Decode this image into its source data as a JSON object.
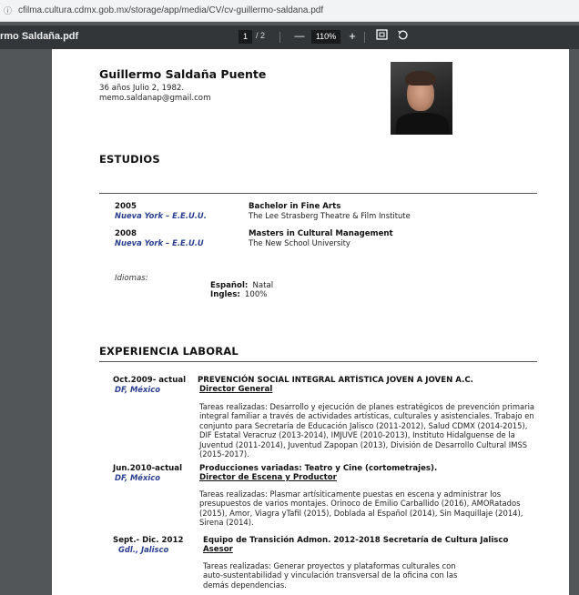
{
  "browser": {
    "url": "cfilma.cultura.cdmx.gob.mx/storage/app/media/CV/cv-guillermo-saldana.pdf"
  },
  "pdf_toolbar": {
    "file_name": "rmo Saldaña.pdf",
    "current_page": "1",
    "total_pages": "/ 2",
    "zoom_out": "—",
    "zoom": "110%",
    "zoom_in": "+"
  },
  "cv": {
    "name": "Guillermo Saldaña Puente",
    "age_birth": "36 años Julio 2, 1982.",
    "email": "memo.saldanap@gmail.com",
    "studies": {
      "heading": "ESTUDIOS",
      "items": [
        {
          "year": "2005",
          "location": "Nueva York – E.E.U.U.",
          "degree": "Bachelor in Fine Arts",
          "institution": "The Lee Strasberg Theatre & Film Institute"
        },
        {
          "year": "2008",
          "location": "Nueva York – E.E.U.U",
          "degree": "Masters in Cultural Management",
          "institution": "The New School University"
        }
      ],
      "languages_label": "Idiomas:",
      "languages": [
        {
          "name": "Español:",
          "level": "Natal"
        },
        {
          "name": "Ingles:",
          "level": "100%"
        }
      ]
    },
    "experience": {
      "heading": "EXPERIENCIA LABORAL",
      "items": [
        {
          "date": "Oct.2009- actual",
          "location": "DF, México",
          "org": "PREVENCIÓN SOCIAL INTEGRAL ARTÍSTICA JOVEN A JOVEN A.C.",
          "role": "Director General",
          "description": "Tareas realizadas: Desarrollo y ejecución de planes estratégicos de prevención primaria integral familiar a través de actividades artísticas, culturales y asistenciales. Trabajo en conjunto para Secretaría de Educación Jalisco (2011-2012), Salud CDMX (2014-2015), DIF Estatal Veracruz (2013-2014), IMJUVE (2010-2013), Instituto Hidalguense de la Juventud (2011-2014), Juventud Zapopan (2013), División de Desarrollo Cultural IMSS (2015-2017)."
        },
        {
          "date": "Jun.2010-actual",
          "location": "DF, México",
          "org": "Producciones variadas: Teatro y Cine (cortometrajes).",
          "role": "Director de Escena y Productor",
          "description": "Tareas realizadas: Plasmar artísiticamente puestas en escena y administrar los presupuestos de varios montajes. Orinoco de Emilio Carballido (2016), AMORatados (2015), Amor, Viagra yTafil (2015), Doblada al Español (2014), Sin Maquillaje (2014), Sirena (2014)."
        },
        {
          "date": "Sept.- Dic. 2012",
          "location": "Gdl., Jalisco",
          "org": "Equipo de Transición Admon. 2012-2018 Secretaría de Cultura Jalisco",
          "role": "Asesor",
          "description": "Tareas realizadas: Generar proyectos y plataformas culturales con auto-sustentabilidad y vinculación transversal de la oficina con las demás dependencias."
        }
      ]
    }
  }
}
